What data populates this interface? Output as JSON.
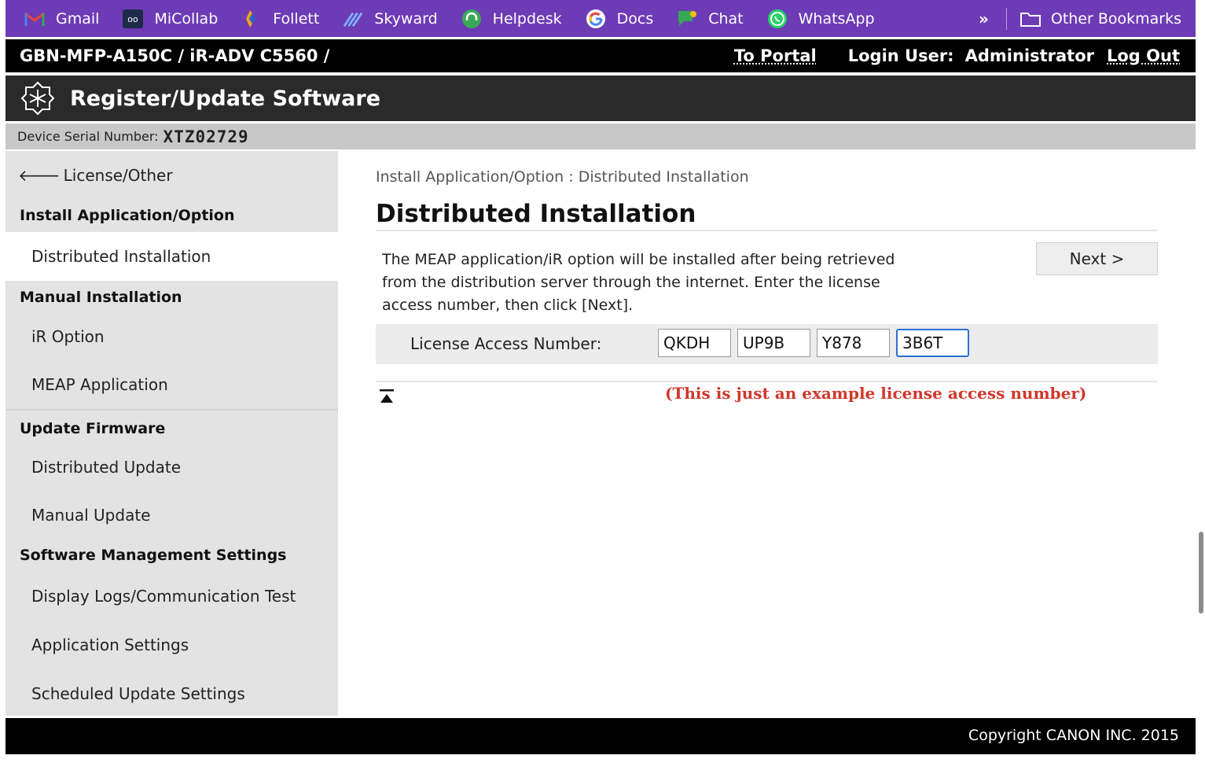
{
  "bookmarks": {
    "items": [
      {
        "label": "Gmail",
        "icon": "gmail-icon"
      },
      {
        "label": "MiCollab",
        "icon": "micollab-icon"
      },
      {
        "label": "Follett",
        "icon": "follett-icon"
      },
      {
        "label": "Skyward",
        "icon": "skyward-icon"
      },
      {
        "label": "Helpdesk",
        "icon": "helpdesk-icon"
      },
      {
        "label": "Docs",
        "icon": "google-icon"
      },
      {
        "label": "Chat",
        "icon": "chat-icon"
      },
      {
        "label": "WhatsApp",
        "icon": "whatsapp-icon"
      }
    ],
    "overflow": "»",
    "other": "Other Bookmarks"
  },
  "device": {
    "name": "GBN-MFP-A150C / iR-ADV C5560 /",
    "to_portal": "To Portal",
    "login_label": "Login User:",
    "login_user": "Administrator",
    "logout": "Log Out"
  },
  "header": {
    "title": "Register/Update Software"
  },
  "serial": {
    "label": "Device Serial Number:",
    "value": "XTZ02729"
  },
  "sidebar": {
    "back": "License/Other",
    "sections": [
      {
        "heading": "Install Application/Option",
        "items": [
          "Distributed Installation"
        ]
      },
      {
        "heading": "Manual Installation",
        "items": [
          "iR Option",
          "MEAP Application"
        ]
      },
      {
        "heading": "Update Firmware",
        "items": [
          "Distributed Update",
          "Manual Update"
        ]
      },
      {
        "heading": "Software Management Settings",
        "items": [
          "Display Logs/Communication Test",
          "Application Settings",
          "Scheduled Update Settings"
        ]
      }
    ],
    "active": "Distributed Installation"
  },
  "main": {
    "breadcrumb": "Install Application/Option : Distributed Installation",
    "title": "Distributed Installation",
    "description_lines": [
      "The MEAP application/iR option will be installed after being retrieved",
      "from the distribution server through the internet. Enter the license",
      "access number, then click [Next]."
    ],
    "next_label": "Next >",
    "license_label": "License Access Number:",
    "license_values": [
      "QKDH",
      "UP9B",
      "Y878",
      "3B6T"
    ],
    "note": "(This is just an example license access number)"
  },
  "footer": {
    "copyright": "Copyright CANON INC. 2015"
  },
  "colors": {
    "bookmark_bar": "#6d3bb5",
    "title_bar": "#2a2a2a",
    "note": "#d0382b",
    "focus": "#2f6fd6"
  }
}
